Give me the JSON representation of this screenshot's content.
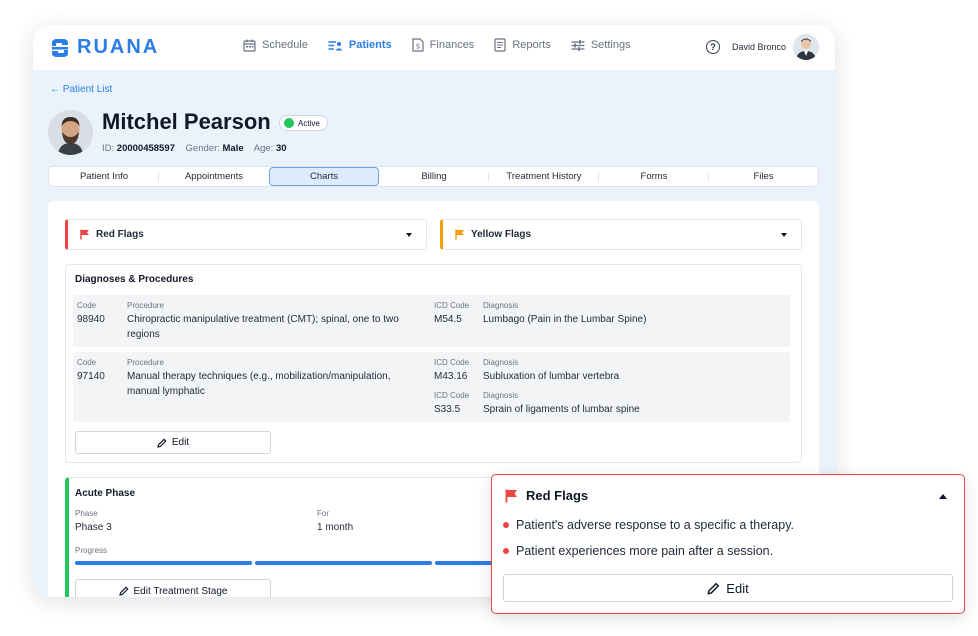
{
  "app": {
    "name": "RUANA",
    "brand_color": "#2b7de9"
  },
  "nav": [
    {
      "label": "Schedule",
      "icon": "calendar-icon",
      "active": false
    },
    {
      "label": "Patients",
      "icon": "patients-list-icon",
      "active": true
    },
    {
      "label": "Finances",
      "icon": "finance-document-icon",
      "active": false
    },
    {
      "label": "Reports",
      "icon": "report-icon",
      "active": false
    },
    {
      "label": "Settings",
      "icon": "sliders-icon",
      "active": false
    }
  ],
  "user": {
    "name": "David Bronco",
    "help": "?"
  },
  "back_link": "← Patient List",
  "patient": {
    "name": "Mitchel Pearson",
    "status": "Active",
    "id_label": "ID:",
    "id": "20000458597",
    "gender_label": "Gender:",
    "gender": "Male",
    "age_label": "Age:",
    "age": "30"
  },
  "tabs": [
    "Patient Info",
    "Appointments",
    "Charts",
    "Billing",
    "Treatment History",
    "Forms",
    "Files"
  ],
  "active_tab": "Charts",
  "flags": {
    "red": {
      "label": "Red Flags",
      "color": "#ef4444"
    },
    "yellow": {
      "label": "Yellow Flags",
      "color": "#f59e0b"
    }
  },
  "diagnoses": {
    "title": "Diagnoses & Procedures",
    "labels": {
      "code": "Code",
      "procedure": "Procedure",
      "icd": "ICD Code",
      "diagnosis": "Diagnosis"
    },
    "rows": [
      {
        "code": "98940",
        "procedure_line1": "Chiropractic manipulative treatment (CMT); spinal, one to two",
        "procedure_line2": "regions",
        "icd": [
          {
            "code": "M54.5",
            "diagnosis": "Lumbago (Pain in the Lumbar Spine)"
          }
        ]
      },
      {
        "code": "97140",
        "procedure_line1": "Manual therapy techniques (e.g., mobilization/manipulation,",
        "procedure_line2": "manual lymphatic",
        "icd": [
          {
            "code": "M43.16",
            "diagnosis": "Subluxation of lumbar vertebra"
          },
          {
            "code": "S33.5",
            "diagnosis": "Sprain of ligaments of lumbar spine"
          }
        ]
      }
    ],
    "edit_label": "Edit"
  },
  "phase": {
    "title": "Acute Phase",
    "phase_label": "Phase",
    "phase_value": "Phase 3",
    "for_label": "For",
    "for_value": "1 month",
    "progress_label": "Progress",
    "edit_label": "Edit Treatment Stage",
    "accent": "#22c55e"
  },
  "red_flags_popup": {
    "title": "Red Flags",
    "items": [
      "Patient's adverse response to a specific a therapy.",
      "Patient experiences more pain after a session."
    ],
    "edit_label": "Edit"
  }
}
